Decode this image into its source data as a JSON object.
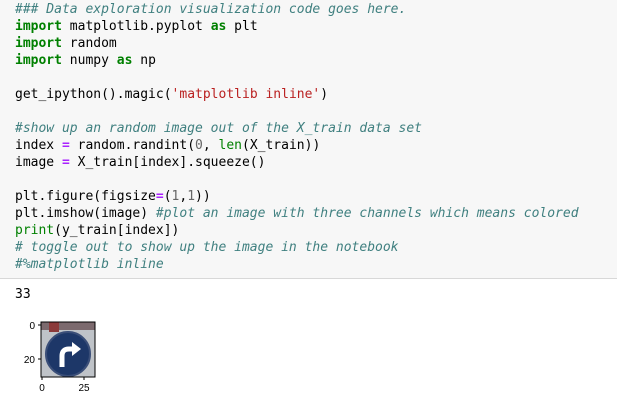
{
  "cell": {
    "lines": [
      [
        {
          "t": "### Data exploration visualization code goes here.",
          "c": "cm"
        }
      ],
      [
        {
          "t": "import",
          "c": "kw"
        },
        {
          "t": " matplotlib.pyplot "
        },
        {
          "t": "as",
          "c": "kw"
        },
        {
          "t": " plt"
        }
      ],
      [
        {
          "t": "import",
          "c": "kw"
        },
        {
          "t": " random"
        }
      ],
      [
        {
          "t": "import",
          "c": "kw"
        },
        {
          "t": " numpy "
        },
        {
          "t": "as",
          "c": "kw"
        },
        {
          "t": " np"
        }
      ],
      [],
      [
        {
          "t": "get_ipython().magic("
        },
        {
          "t": "'matplotlib inline'",
          "c": "st"
        },
        {
          "t": ")"
        }
      ],
      [],
      [
        {
          "t": "#show up an random image out of the X_train data set",
          "c": "cm"
        }
      ],
      [
        {
          "t": "index "
        },
        {
          "t": "=",
          "c": "op"
        },
        {
          "t": " random.randint("
        },
        {
          "t": "0",
          "c": "nu"
        },
        {
          "t": ", "
        },
        {
          "t": "len",
          "c": "bi"
        },
        {
          "t": "(X_train))"
        }
      ],
      [
        {
          "t": "image "
        },
        {
          "t": "=",
          "c": "op"
        },
        {
          "t": " X_train[index].squeeze()"
        }
      ],
      [],
      [
        {
          "t": "plt.figure(figsize"
        },
        {
          "t": "=",
          "c": "op"
        },
        {
          "t": "("
        },
        {
          "t": "1",
          "c": "nu"
        },
        {
          "t": ","
        },
        {
          "t": "1",
          "c": "nu"
        },
        {
          "t": "))"
        }
      ],
      [
        {
          "t": "plt.imshow(image) "
        },
        {
          "t": "#plot an image with three channels which means colored",
          "c": "cm"
        }
      ],
      [
        {
          "t": "print",
          "c": "bi"
        },
        {
          "t": "(y_train[index])"
        }
      ],
      [
        {
          "t": "# toggle out to show up the image in the notebook",
          "c": "cm"
        }
      ],
      [
        {
          "t": "#%matplotlib inline",
          "c": "cm"
        }
      ]
    ]
  },
  "output": {
    "text": "33",
    "plot": {
      "y_ticks": [
        "0",
        "20"
      ],
      "x_ticks": [
        "0",
        "25"
      ],
      "image_subject": "blue-round-sign-turn-right-arrow",
      "colors": {
        "sign": "#1d3768",
        "arrow": "#ffffff",
        "background": "#bfc3c8"
      }
    }
  }
}
